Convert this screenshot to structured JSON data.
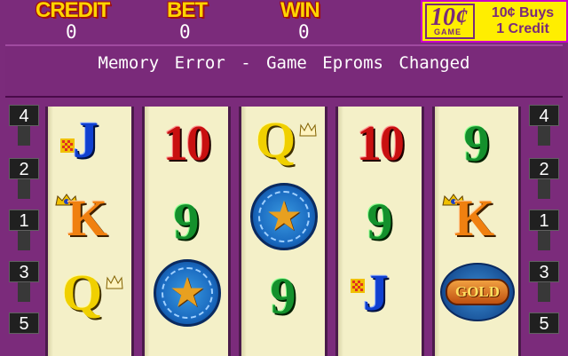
{
  "meters": {
    "credit": {
      "label": "CREDIT",
      "value": "0"
    },
    "bet": {
      "label": "BET",
      "value": "0"
    },
    "win": {
      "label": "WIN",
      "value": "0"
    }
  },
  "denomination": {
    "badge_big": "10¢",
    "badge_small": "GAME",
    "line1": "10¢ Buys",
    "line2": "1 Credit"
  },
  "message": "Memory Error - Game Eproms Changed",
  "line_indicators": {
    "left": [
      "4",
      "2",
      "1",
      "3",
      "5"
    ],
    "right": [
      "4",
      "2",
      "1",
      "3",
      "5"
    ]
  },
  "reels": [
    [
      "J",
      "K",
      "Q"
    ],
    [
      "10",
      "9",
      "star"
    ],
    [
      "Q",
      "star",
      "9"
    ],
    [
      "10",
      "9",
      "J"
    ],
    [
      "9",
      "K",
      "GOLD"
    ]
  ],
  "gold_symbol_text": "GOLD",
  "colors": {
    "background": "#7b2b7b",
    "meter_label": "#ffd400",
    "reel_bg": "#f4f0c8"
  }
}
